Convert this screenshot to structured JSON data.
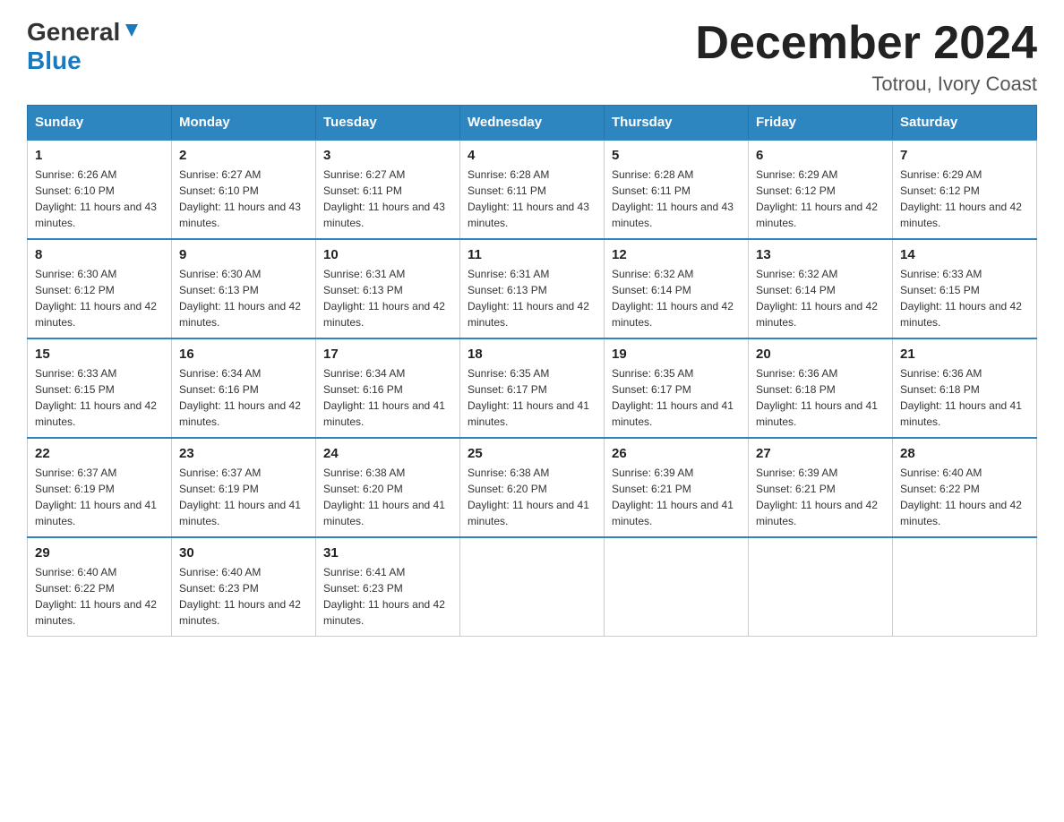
{
  "logo": {
    "general": "General",
    "blue": "Blue"
  },
  "title": "December 2024",
  "subtitle": "Totrou, Ivory Coast",
  "days_of_week": [
    "Sunday",
    "Monday",
    "Tuesday",
    "Wednesday",
    "Thursday",
    "Friday",
    "Saturday"
  ],
  "weeks": [
    [
      {
        "day": "1",
        "sunrise": "6:26 AM",
        "sunset": "6:10 PM",
        "daylight": "11 hours and 43 minutes."
      },
      {
        "day": "2",
        "sunrise": "6:27 AM",
        "sunset": "6:10 PM",
        "daylight": "11 hours and 43 minutes."
      },
      {
        "day": "3",
        "sunrise": "6:27 AM",
        "sunset": "6:11 PM",
        "daylight": "11 hours and 43 minutes."
      },
      {
        "day": "4",
        "sunrise": "6:28 AM",
        "sunset": "6:11 PM",
        "daylight": "11 hours and 43 minutes."
      },
      {
        "day": "5",
        "sunrise": "6:28 AM",
        "sunset": "6:11 PM",
        "daylight": "11 hours and 43 minutes."
      },
      {
        "day": "6",
        "sunrise": "6:29 AM",
        "sunset": "6:12 PM",
        "daylight": "11 hours and 42 minutes."
      },
      {
        "day": "7",
        "sunrise": "6:29 AM",
        "sunset": "6:12 PM",
        "daylight": "11 hours and 42 minutes."
      }
    ],
    [
      {
        "day": "8",
        "sunrise": "6:30 AM",
        "sunset": "6:12 PM",
        "daylight": "11 hours and 42 minutes."
      },
      {
        "day": "9",
        "sunrise": "6:30 AM",
        "sunset": "6:13 PM",
        "daylight": "11 hours and 42 minutes."
      },
      {
        "day": "10",
        "sunrise": "6:31 AM",
        "sunset": "6:13 PM",
        "daylight": "11 hours and 42 minutes."
      },
      {
        "day": "11",
        "sunrise": "6:31 AM",
        "sunset": "6:13 PM",
        "daylight": "11 hours and 42 minutes."
      },
      {
        "day": "12",
        "sunrise": "6:32 AM",
        "sunset": "6:14 PM",
        "daylight": "11 hours and 42 minutes."
      },
      {
        "day": "13",
        "sunrise": "6:32 AM",
        "sunset": "6:14 PM",
        "daylight": "11 hours and 42 minutes."
      },
      {
        "day": "14",
        "sunrise": "6:33 AM",
        "sunset": "6:15 PM",
        "daylight": "11 hours and 42 minutes."
      }
    ],
    [
      {
        "day": "15",
        "sunrise": "6:33 AM",
        "sunset": "6:15 PM",
        "daylight": "11 hours and 42 minutes."
      },
      {
        "day": "16",
        "sunrise": "6:34 AM",
        "sunset": "6:16 PM",
        "daylight": "11 hours and 42 minutes."
      },
      {
        "day": "17",
        "sunrise": "6:34 AM",
        "sunset": "6:16 PM",
        "daylight": "11 hours and 41 minutes."
      },
      {
        "day": "18",
        "sunrise": "6:35 AM",
        "sunset": "6:17 PM",
        "daylight": "11 hours and 41 minutes."
      },
      {
        "day": "19",
        "sunrise": "6:35 AM",
        "sunset": "6:17 PM",
        "daylight": "11 hours and 41 minutes."
      },
      {
        "day": "20",
        "sunrise": "6:36 AM",
        "sunset": "6:18 PM",
        "daylight": "11 hours and 41 minutes."
      },
      {
        "day": "21",
        "sunrise": "6:36 AM",
        "sunset": "6:18 PM",
        "daylight": "11 hours and 41 minutes."
      }
    ],
    [
      {
        "day": "22",
        "sunrise": "6:37 AM",
        "sunset": "6:19 PM",
        "daylight": "11 hours and 41 minutes."
      },
      {
        "day": "23",
        "sunrise": "6:37 AM",
        "sunset": "6:19 PM",
        "daylight": "11 hours and 41 minutes."
      },
      {
        "day": "24",
        "sunrise": "6:38 AM",
        "sunset": "6:20 PM",
        "daylight": "11 hours and 41 minutes."
      },
      {
        "day": "25",
        "sunrise": "6:38 AM",
        "sunset": "6:20 PM",
        "daylight": "11 hours and 41 minutes."
      },
      {
        "day": "26",
        "sunrise": "6:39 AM",
        "sunset": "6:21 PM",
        "daylight": "11 hours and 41 minutes."
      },
      {
        "day": "27",
        "sunrise": "6:39 AM",
        "sunset": "6:21 PM",
        "daylight": "11 hours and 42 minutes."
      },
      {
        "day": "28",
        "sunrise": "6:40 AM",
        "sunset": "6:22 PM",
        "daylight": "11 hours and 42 minutes."
      }
    ],
    [
      {
        "day": "29",
        "sunrise": "6:40 AM",
        "sunset": "6:22 PM",
        "daylight": "11 hours and 42 minutes."
      },
      {
        "day": "30",
        "sunrise": "6:40 AM",
        "sunset": "6:23 PM",
        "daylight": "11 hours and 42 minutes."
      },
      {
        "day": "31",
        "sunrise": "6:41 AM",
        "sunset": "6:23 PM",
        "daylight": "11 hours and 42 minutes."
      },
      null,
      null,
      null,
      null
    ]
  ]
}
